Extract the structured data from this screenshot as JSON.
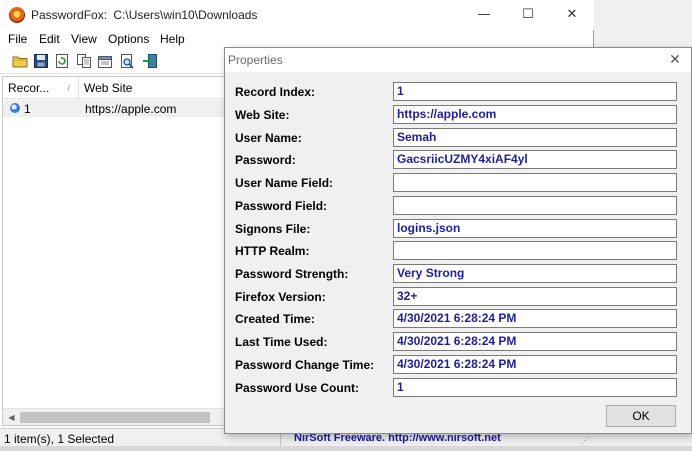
{
  "main_window": {
    "title_app": "PasswordFox:",
    "title_path": "C:\\Users\\win10\\Downloads",
    "controls": {
      "minimize": "—",
      "maximize": "☐",
      "close": "✕"
    }
  },
  "menu": [
    "File",
    "Edit",
    "View",
    "Options",
    "Help"
  ],
  "toolbar": {
    "icons": [
      "open-folder-icon",
      "save-icon",
      "refresh-icon",
      "copy-icon",
      "properties-icon",
      "find-icon",
      "exit-icon"
    ]
  },
  "list": {
    "columns": [
      "Recor...",
      "Web Site"
    ],
    "sort_indicator": "/",
    "rows": [
      {
        "index": "1",
        "site": "https://apple.com"
      }
    ]
  },
  "statusbar": {
    "count": "1 item(s), 1 Selected",
    "link": "NirSoft Freeware.  http://www.nirsoft.net"
  },
  "dialog": {
    "title": "Properties",
    "close": "✕",
    "ok_label": "OK",
    "fields": [
      {
        "label": "Record Index:",
        "value": "1"
      },
      {
        "label": "Web Site:",
        "value": "https://apple.com"
      },
      {
        "label": "User Name:",
        "value": "Semah"
      },
      {
        "label": "Password:",
        "value": "GacsriicUZMY4xiAF4yl"
      },
      {
        "label": "User Name Field:",
        "value": ""
      },
      {
        "label": "Password Field:",
        "value": ""
      },
      {
        "label": "Signons File:",
        "value": "logins.json"
      },
      {
        "label": "HTTP Realm:",
        "value": ""
      },
      {
        "label": "Password Strength:",
        "value": "Very Strong"
      },
      {
        "label": "Firefox Version:",
        "value": "32+"
      },
      {
        "label": "Created Time:",
        "value": "4/30/2021 6:28:24 PM"
      },
      {
        "label": "Last Time Used:",
        "value": "4/30/2021 6:28:24 PM"
      },
      {
        "label": "Password Change Time:",
        "value": "4/30/2021 6:28:24 PM"
      },
      {
        "label": "Password Use Count:",
        "value": "1"
      }
    ]
  },
  "colors": {
    "value_text": "#1e1e9c",
    "link_text": "#1a1aa6",
    "dialog_bg": "#f0f0f0"
  }
}
